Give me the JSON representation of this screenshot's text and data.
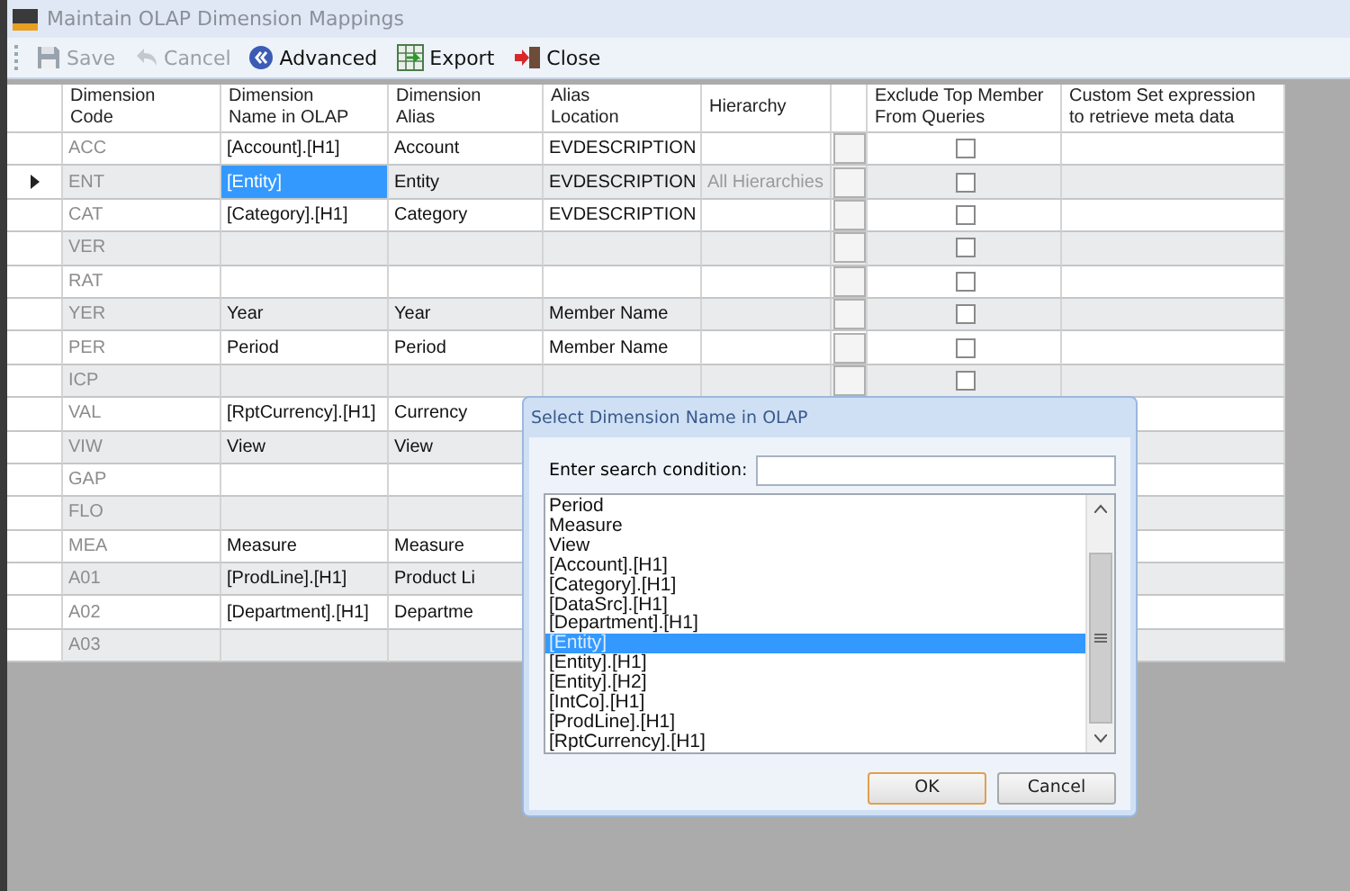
{
  "window": {
    "title": "Maintain OLAP Dimension Mappings"
  },
  "toolbar": [
    {
      "label": "Save",
      "kind": "save",
      "disabled": true
    },
    {
      "label": "Cancel",
      "kind": "cancel",
      "disabled": true
    },
    {
      "label": "Advanced",
      "kind": "advanced",
      "disabled": false
    },
    {
      "label": "Export",
      "kind": "export",
      "disabled": false
    },
    {
      "label": "Close",
      "kind": "close",
      "disabled": false
    }
  ],
  "table": {
    "columns": [
      "Dimension\nCode",
      "Dimension\nName in OLAP",
      "Dimension\nAlias",
      "Alias\nLocation",
      "Hierarchy",
      "Exclude Top Member\nFrom Queries",
      "Custom Set expression\nto retrieve meta data"
    ],
    "rows": [
      {
        "code": "ACC",
        "name": "[Account].[H1]",
        "alias": "Account",
        "location": "EVDESCRIPTION",
        "current": false,
        "name_selected": false,
        "exclude_checked": false
      },
      {
        "code": "ENT",
        "name": "[Entity]",
        "alias": "Entity",
        "location": "EVDESCRIPTION",
        "hierarchy": "All Hierarchies",
        "current": true,
        "name_selected": true,
        "exclude_checked": false
      },
      {
        "code": "CAT",
        "name": "[Category].[H1]",
        "alias": "Category",
        "location": "EVDESCRIPTION",
        "current": false,
        "name_selected": false,
        "exclude_checked": false
      },
      {
        "code": "VER",
        "current": false,
        "name_selected": false,
        "exclude_checked": false
      },
      {
        "code": "RAT",
        "current": false,
        "name_selected": false,
        "exclude_checked": false
      },
      {
        "code": "YER",
        "name": "Year",
        "alias": "Year",
        "location": "Member Name",
        "current": false,
        "name_selected": false,
        "exclude_checked": false
      },
      {
        "code": "PER",
        "name": "Period",
        "alias": "Period",
        "location": "Member Name",
        "current": false,
        "name_selected": false,
        "exclude_checked": false
      },
      {
        "code": "ICP",
        "current": false,
        "name_selected": false,
        "exclude_checked": false
      },
      {
        "code": "VAL",
        "name": "[RptCurrency].[H1]",
        "alias": "Currency",
        "current": false,
        "name_selected": false
      },
      {
        "code": "VIW",
        "name": "View",
        "alias": "View",
        "current": false,
        "name_selected": false
      },
      {
        "code": "GAP",
        "current": false,
        "name_selected": false
      },
      {
        "code": "FLO",
        "current": false,
        "name_selected": false
      },
      {
        "code": "MEA",
        "name": "Measure",
        "alias": "Measure",
        "current": false,
        "name_selected": false
      },
      {
        "code": "A01",
        "name": "[ProdLine].[H1]",
        "alias": "Product Li",
        "current": false,
        "name_selected": false
      },
      {
        "code": "A02",
        "name": "[Department].[H1]",
        "alias": "Departme",
        "current": false,
        "name_selected": false
      },
      {
        "code": "A03",
        "current": false,
        "name_selected": false
      }
    ]
  },
  "dialog": {
    "title": "Select Dimension Name in OLAP",
    "search_label": "Enter search condition:",
    "items": [
      {
        "label": "Period",
        "selected": false
      },
      {
        "label": "Measure",
        "selected": false
      },
      {
        "label": "View",
        "selected": false
      },
      {
        "label": "[Account].[H1]",
        "selected": false
      },
      {
        "label": "[Category].[H1]",
        "selected": false
      },
      {
        "label": "[DataSrc].[H1]",
        "selected": false
      },
      {
        "label": "[Department].[H1]",
        "selected": false
      },
      {
        "label": "[Entity]",
        "selected": true
      },
      {
        "label": "[Entity].[H1]",
        "selected": false
      },
      {
        "label": "[Entity].[H2]",
        "selected": false
      },
      {
        "label": "[IntCo].[H1]",
        "selected": false
      },
      {
        "label": "[ProdLine].[H1]",
        "selected": false
      },
      {
        "label": "[RptCurrency].[H1]",
        "selected": false
      }
    ],
    "buttons": [
      {
        "label": "OK",
        "kind": "default"
      },
      {
        "label": "Cancel",
        "kind": "normal"
      }
    ]
  }
}
